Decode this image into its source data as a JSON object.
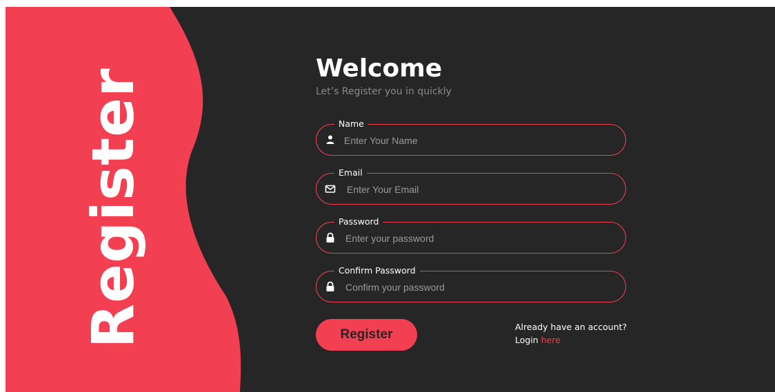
{
  "colors": {
    "accent": "#f23f52",
    "background": "#262626",
    "text": "#ffffff",
    "placeholder": "#9a9a9a"
  },
  "side_panel": {
    "title": "Register"
  },
  "header": {
    "title": "Welcome",
    "subtitle": "Let’s Register you in quickly"
  },
  "form": {
    "fields": [
      {
        "label": "Name",
        "placeholder": "Enter Your Name",
        "value": "",
        "icon": "user-icon"
      },
      {
        "label": "Email",
        "placeholder": "Enter Your Email",
        "value": "",
        "icon": "envelope-icon"
      },
      {
        "label": "Password",
        "placeholder": "Enter your password",
        "value": "",
        "icon": "lock-icon"
      },
      {
        "label": "Confirm Password",
        "placeholder": "Confirm your password",
        "value": "",
        "icon": "lock-icon"
      }
    ],
    "submit_label": "Register"
  },
  "footer": {
    "prompt": "Already have an account?",
    "login_prefix": "Login",
    "login_link": "here"
  }
}
